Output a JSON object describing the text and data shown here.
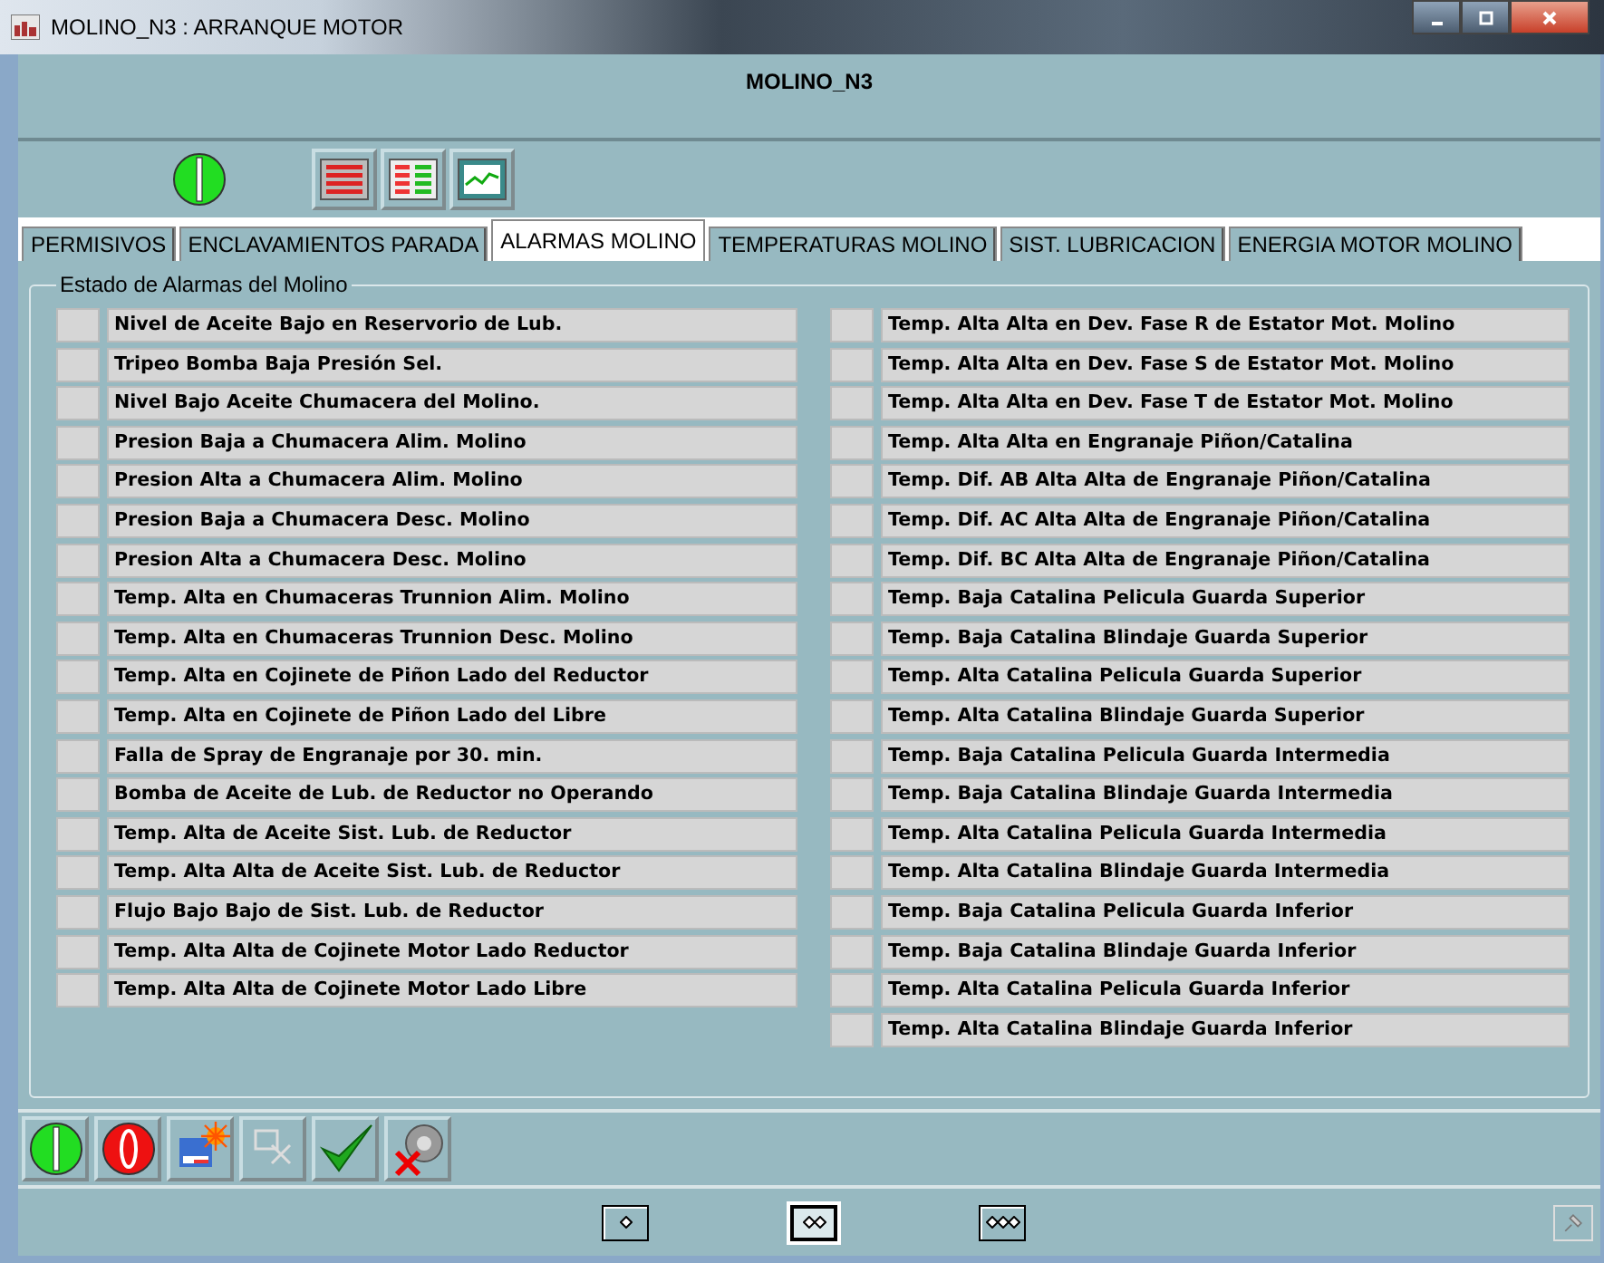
{
  "window": {
    "title": "MOLINO_N3 : ARRANQUE MOTOR"
  },
  "header": {
    "title": "MOLINO_N3"
  },
  "toolbar": {
    "status_on": true
  },
  "tabs": [
    {
      "label": "PERMISIVOS",
      "selected": false
    },
    {
      "label": "ENCLAVAMIENTOS PARADA",
      "selected": false
    },
    {
      "label": "ALARMAS MOLINO",
      "selected": true
    },
    {
      "label": "TEMPERATURAS MOLINO",
      "selected": false
    },
    {
      "label": "SIST. LUBRICACION",
      "selected": false
    },
    {
      "label": "ENERGIA MOTOR MOLINO",
      "selected": false
    }
  ],
  "group": {
    "title": "Estado de Alarmas del Molino"
  },
  "alarms_left": [
    {
      "label": "Nivel de Aceite Bajo en Reservorio de Lub.",
      "active": false
    },
    {
      "label": "Tripeo Bomba Baja Presión Sel.",
      "active": false
    },
    {
      "label": "Nivel Bajo Aceite Chumacera del Molino.",
      "active": false
    },
    {
      "label": "Presion Baja a Chumacera Alim. Molino",
      "active": false
    },
    {
      "label": "Presion Alta a Chumacera Alim. Molino",
      "active": false
    },
    {
      "label": "Presion Baja a Chumacera Desc. Molino",
      "active": false
    },
    {
      "label": "Presion Alta a Chumacera Desc. Molino",
      "active": false
    },
    {
      "label": "Temp. Alta en Chumaceras Trunnion Alim. Molino",
      "active": false
    },
    {
      "label": "Temp. Alta en Chumaceras Trunnion Desc. Molino",
      "active": false
    },
    {
      "label": "Temp. Alta en Cojinete de Piñon Lado del Reductor",
      "active": false
    },
    {
      "label": "Temp. Alta en Cojinete de Piñon Lado del Libre",
      "active": false
    },
    {
      "label": "Falla de Spray de Engranaje por 30. min.",
      "active": false
    },
    {
      "label": "Bomba de Aceite de Lub. de Reductor no Operando",
      "active": false
    },
    {
      "label": "Temp. Alta de Aceite Sist. Lub. de Reductor",
      "active": false
    },
    {
      "label": "Temp. Alta Alta de Aceite Sist. Lub. de Reductor",
      "active": false
    },
    {
      "label": "Flujo Bajo Bajo de Sist. Lub. de Reductor",
      "active": false
    },
    {
      "label": "Temp. Alta Alta de Cojinete Motor Lado Reductor",
      "active": false
    },
    {
      "label": "Temp. Alta Alta de Cojinete Motor Lado Libre",
      "active": false
    }
  ],
  "alarms_right": [
    {
      "label": "Temp. Alta Alta en Dev. Fase R de Estator Mot. Molino",
      "active": false
    },
    {
      "label": "Temp. Alta Alta en Dev. Fase S de Estator Mot. Molino",
      "active": false
    },
    {
      "label": "Temp. Alta Alta en Dev. Fase T de Estator Mot. Molino",
      "active": false
    },
    {
      "label": "Temp. Alta Alta en Engranaje Piñon/Catalina",
      "active": false
    },
    {
      "label": "Temp. Dif. AB Alta Alta de Engranaje Piñon/Catalina",
      "active": false
    },
    {
      "label": "Temp. Dif. AC Alta Alta de Engranaje Piñon/Catalina",
      "active": false
    },
    {
      "label": "Temp. Dif. BC Alta Alta de Engranaje Piñon/Catalina",
      "active": false
    },
    {
      "label": "Temp. Baja Catalina Pelicula Guarda Superior",
      "active": false
    },
    {
      "label": "Temp. Baja Catalina Blindaje Guarda Superior",
      "active": false
    },
    {
      "label": "Temp. Alta Catalina Pelicula Guarda Superior",
      "active": false
    },
    {
      "label": "Temp. Alta Catalina Blindaje Guarda Superior",
      "active": false
    },
    {
      "label": "Temp. Baja Catalina Pelicula Guarda Intermedia",
      "active": false
    },
    {
      "label": "Temp. Baja Catalina Blindaje Guarda Intermedia",
      "active": false
    },
    {
      "label": "Temp. Alta Catalina Pelicula Guarda Intermedia",
      "active": false
    },
    {
      "label": "Temp. Alta Catalina Blindaje Guarda Intermedia",
      "active": false
    },
    {
      "label": "Temp. Baja Catalina Pelicula Guarda Inferior",
      "active": false
    },
    {
      "label": "Temp. Baja Catalina Blindaje Guarda Inferior",
      "active": false
    },
    {
      "label": "Temp. Alta Catalina Pelicula Guarda Inferior",
      "active": false
    },
    {
      "label": "Temp. Alta Catalina Blindaje Guarda Inferior",
      "active": false
    }
  ],
  "view_buttons": [
    {
      "selected": false
    },
    {
      "selected": true
    },
    {
      "selected": false
    }
  ]
}
